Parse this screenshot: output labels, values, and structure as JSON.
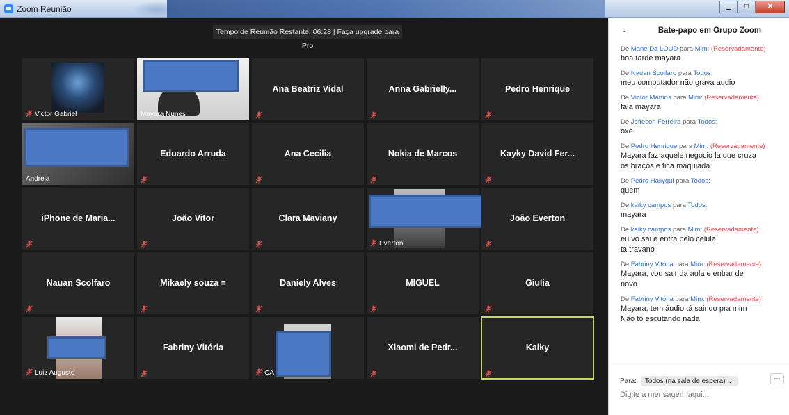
{
  "window": {
    "title": "Zoom Reunião"
  },
  "banner": {
    "text": "Tempo de Reunião Restante: 06:28 | Faça upgrade para Pro"
  },
  "participants": [
    {
      "name": "Victor Gabriel",
      "style": "label"
    },
    {
      "name": "Mayara Nunes",
      "style": "label"
    },
    {
      "name": "Ana Beatriz Vidal",
      "style": "center"
    },
    {
      "name": "Anna  Gabrielly...",
      "style": "center"
    },
    {
      "name": "Pedro Henrique",
      "style": "center"
    },
    {
      "name": "Andreia",
      "style": "label"
    },
    {
      "name": "Eduardo Arruda",
      "style": "center"
    },
    {
      "name": "Ana Cecilia",
      "style": "center"
    },
    {
      "name": "Nokia de Marcos",
      "style": "center"
    },
    {
      "name": "Kayky David Fer...",
      "style": "center"
    },
    {
      "name": "iPhone de Maria...",
      "style": "center"
    },
    {
      "name": "João Vitor",
      "style": "center"
    },
    {
      "name": "Clara Maviany",
      "style": "center"
    },
    {
      "name": "Everton",
      "style": "label"
    },
    {
      "name": "João Everton",
      "style": "center"
    },
    {
      "name": "Nauan Scolfaro",
      "style": "center"
    },
    {
      "name": "Mikaely  souza ≡",
      "style": "center"
    },
    {
      "name": "Daniely Alves",
      "style": "center"
    },
    {
      "name": "MIGUEL",
      "style": "center"
    },
    {
      "name": "Giulia",
      "style": "center"
    },
    {
      "name": "Luiz Augusto",
      "style": "label"
    },
    {
      "name": "Fabriny Vitória",
      "style": "center"
    },
    {
      "name": "CA",
      "style": "label"
    },
    {
      "name": "Xiaomi de Pedr...",
      "style": "center"
    },
    {
      "name": "Kaiky",
      "style": "center",
      "active": true
    }
  ],
  "chat": {
    "title": "Bate-papo em Grupo Zoom",
    "collapse_icon": "chevron-down-icon",
    "messages": [
      {
        "from": "Mané Da LOUD",
        "to": "Mim:",
        "private": "(Reservadamente)",
        "text": "boa tarde mayara"
      },
      {
        "from": "Nauan Scolfaro",
        "to": "Todos:",
        "private": "",
        "text": "meu computador não grava audio"
      },
      {
        "from": "Victor Martins",
        "to": "Mim:",
        "private": "(Reservadamente)",
        "text": "fala mayara"
      },
      {
        "from": "Jeffeson Ferreira",
        "to": "Todos:",
        "private": "",
        "text": "oxe"
      },
      {
        "from": "Pedro Henrique",
        "to": "Mim:",
        "private": "(Reservadamente)",
        "text": "Mayara faz aquele negocio la que cruza\nos braços e fica maquiada"
      },
      {
        "from": "Pedro Hallygui",
        "to": "Todos:",
        "private": "",
        "text": "quem"
      },
      {
        "from": "kaiky campos",
        "to": "Todos:",
        "private": "",
        "text": "mayara"
      },
      {
        "from": "kaiky campos",
        "to": "Mim:",
        "private": "(Reservadamente)",
        "text": "eu vo sai e entra pelo celula\nta travano"
      },
      {
        "from": "Fabriny Vitória",
        "to": "Mim:",
        "private": "(Reservadamente)",
        "text": "Mayara, vou sair da aula e entrar de\nnovo"
      },
      {
        "from": "Fabriny Vitória",
        "to": "Mim:",
        "private": "(Reservadamente)",
        "text": "Mayara, tem áudio tá saindo pra mim\nNão tô escutando nada"
      }
    ],
    "meta_de": "De",
    "meta_para": "para",
    "to_label": "Para:",
    "to_value": "Todos (na sala de espera) ⌄",
    "more_label": "···",
    "input_placeholder": "Digite a mensagem aqui..."
  }
}
